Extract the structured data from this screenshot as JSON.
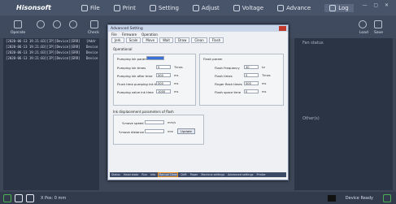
{
  "app": {
    "brand": "Hisonsoft",
    "menu": [
      "File",
      "Print",
      "Setting",
      "Adjust",
      "Voltage",
      "Advance",
      "Log"
    ],
    "active_menu": "Log"
  },
  "toolbar": {
    "left_label": "Operate",
    "mid_label": "Check",
    "right_labels": [
      "Load",
      "Save"
    ]
  },
  "log_lines": [
    "[2020-06-13 19:21:03][IP][Device][ERR]",
    "[2020-06-13 19:21:03][IP][Device][ERR]",
    "[2020-06-13 19:21:03][IP][Device][ERR]",
    "[2020-06-13 19:21:03][IP][Device][ERR]"
  ],
  "log_side": [
    "[Addr",
    "Device",
    "Device",
    "Device"
  ],
  "right_panel": {
    "top_label": "Fan status",
    "mid_label": "Other(s)"
  },
  "status": {
    "text": "X Pos: 0 mm",
    "right": "Device Ready"
  },
  "dialog": {
    "title": "Advanced Setting",
    "menu": [
      "File",
      "Firmware",
      "Operation"
    ],
    "tabs": [
      "Jerk",
      "Scale",
      "Move",
      "Wait",
      "Draw",
      "Clean",
      "Flash"
    ],
    "section": "Operational",
    "pump_group": {
      "pumping_ink_params_label": "Pumping ink params",
      "fields": [
        {
          "label": "Pumping ink times",
          "value": "5",
          "unit": "Times"
        },
        {
          "label": "Pumping ink after time",
          "value": "500",
          "unit": "ms"
        },
        {
          "label": "Flush time pumping ink times",
          "value": "500",
          "unit": "ms"
        },
        {
          "label": "Pumping valve ink time",
          "value": "1000",
          "unit": "ms"
        }
      ]
    },
    "flash_group": {
      "label": "Flash param",
      "fields": [
        {
          "label": "Flash Frequency",
          "value": "30",
          "unit": "hz"
        },
        {
          "label": "Flash times",
          "value": "5",
          "unit": "Times"
        },
        {
          "label": "Finger flash times",
          "value": "500",
          "unit": "ms"
        },
        {
          "label": "Flash space time",
          "value": "0",
          "unit": "ms"
        }
      ]
    },
    "displacement_group": {
      "title": "Ink displacement parameters of flash",
      "fields": [
        {
          "label": "Y-move speed",
          "value": "",
          "unit": "mm/s"
        },
        {
          "label": "Y-move distance",
          "value": "",
          "unit": "mm"
        }
      ],
      "button": "Update"
    },
    "status_items": [
      "Status",
      "Head state",
      "Run",
      "Info",
      "Manual Clean",
      "Drift",
      "Paper",
      "Machine settings",
      "Advanced settings",
      "Printer"
    ],
    "status_selected_index": 4
  }
}
